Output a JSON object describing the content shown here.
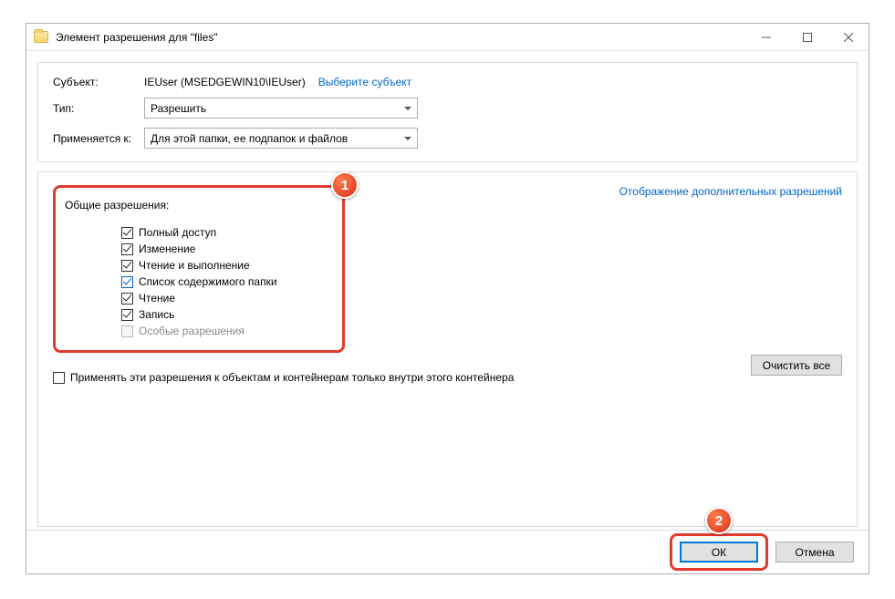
{
  "title": "Элемент разрешения для \"files\"",
  "labels": {
    "subject": "Субъект:",
    "type": "Тип:",
    "applies": "Применяется к:"
  },
  "principal": "IEUser (MSEDGEWIN10\\IEUser)",
  "selectPrincipal": "Выберите субъект",
  "typeValue": "Разрешить",
  "appliesValue": "Для этой папки, ее подпапок и файлов",
  "permTitle": "Общие разрешения:",
  "advancedLink": "Отображение дополнительных разрешений",
  "perms": {
    "full": "Полный доступ",
    "modify": "Изменение",
    "readexec": "Чтение и выполнение",
    "list": "Список содержимого папки",
    "read": "Чтение",
    "write": "Запись",
    "special": "Особые разрешения"
  },
  "applyOnly": "Применять эти разрешения к объектам и контейнерам только внутри этого контейнера",
  "clearAll": "Очистить все",
  "ok": "ОК",
  "cancel": "Отмена",
  "markers": {
    "one": "1",
    "two": "2"
  }
}
